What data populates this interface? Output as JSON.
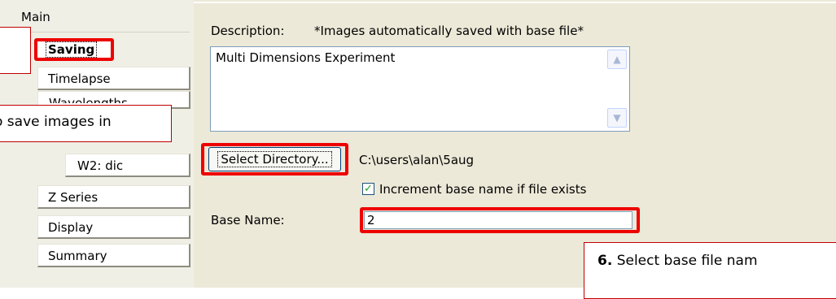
{
  "nav": {
    "main_label": "Main",
    "saving_label": "Saving",
    "timelapse_label": "Timelapse",
    "wavelengths_label_partial": "Wavelengths",
    "w2_label": "W2: dic",
    "zseries_label": "Z Series",
    "display_label": "Display",
    "summary_label": "Summary"
  },
  "content": {
    "description_label": "Description:",
    "auto_save_note": "*Images automatically saved with base file*",
    "description_value": "Multi Dimensions Experiment",
    "select_directory_label": "Select Directory...",
    "directory_path": "C:\\users\\alan\\5aug",
    "increment_checkbox_label": "Increment base name if file exists",
    "increment_checked": true,
    "base_name_label": "Base Name:",
    "base_name_value": "2"
  },
  "callouts": {
    "save_images_text": "o save images in",
    "step_number": "6.",
    "step_text": " Select base file nam"
  },
  "colors": {
    "highlight": "#ee0000",
    "panel_bg": "#ece9d8",
    "nav_bg": "#f0efe6"
  }
}
